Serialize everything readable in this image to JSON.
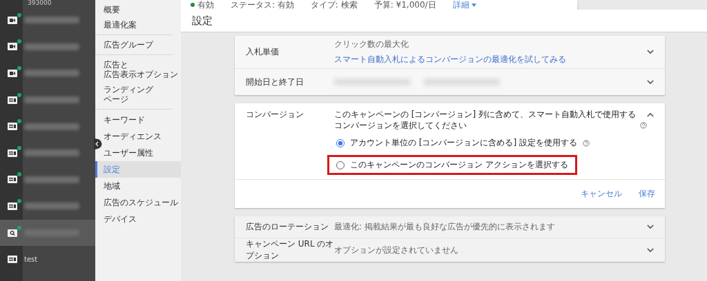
{
  "account": {
    "id": "393000"
  },
  "campaigns": [
    {
      "kind": "video",
      "active": true,
      "selected": false
    },
    {
      "kind": "video",
      "active": true,
      "selected": false
    },
    {
      "kind": "video",
      "active": true,
      "selected": false
    },
    {
      "kind": "display",
      "active": true,
      "selected": false
    },
    {
      "kind": "display",
      "active": true,
      "selected": false
    },
    {
      "kind": "display",
      "active": true,
      "selected": false
    },
    {
      "kind": "display",
      "active": true,
      "selected": false
    },
    {
      "kind": "display",
      "active": true,
      "selected": false
    },
    {
      "kind": "search",
      "active": true,
      "selected": true
    },
    {
      "kind": "display",
      "active": false,
      "selected": false,
      "name": "test"
    }
  ],
  "nav_groups": [
    [
      {
        "label": "概要",
        "selected": false
      },
      {
        "label": "最適化案",
        "selected": false
      }
    ],
    [
      {
        "label": "広告グループ",
        "selected": false
      }
    ],
    [
      {
        "lines": [
          "広告と",
          "広告表示オプション"
        ],
        "selected": false
      },
      {
        "lines": [
          "ランディング",
          "ページ"
        ],
        "selected": false
      }
    ],
    [
      {
        "label": "キーワード",
        "selected": false
      },
      {
        "label": "オーディエンス",
        "selected": false
      },
      {
        "label": "ユーザー属性",
        "selected": false
      },
      {
        "label": "設定",
        "selected": true
      },
      {
        "label": "地域",
        "selected": false
      },
      {
        "label": "広告のスケジュール",
        "selected": false
      },
      {
        "label": "デバイス",
        "selected": false
      }
    ]
  ],
  "summary_bar": {
    "status": "有効",
    "items": [
      "ステータス: 有効",
      "タイプ: 検索",
      "予算: ¥1,000/日"
    ],
    "details_link": "詳細",
    "details_caret": true
  },
  "page_title": "設定",
  "settings_top": [
    {
      "kind": "text",
      "label": "入札単価",
      "value": "クリック数の最大化",
      "link": "スマート自動入札によるコンバージョンの最適化を試してみる",
      "expanded": false
    },
    {
      "kind": "blurred",
      "label": "開始日と終了日",
      "expanded": false
    }
  ],
  "conversion": {
    "label": "コンバージョン",
    "expanded": true,
    "description_help": true,
    "description": "このキャンペーンの [コンバージョン] 列に含めて、スマート自動入札で使用するコンバージョンを選択してください",
    "options": [
      {
        "label": "アカウント単位の [コンバージョンに含める] 設定を使用する",
        "selected": true,
        "help": true,
        "highlighted": false
      },
      {
        "label": "このキャンペーンのコンバージョン アクションを選択する",
        "selected": false,
        "help": false,
        "highlighted": true
      }
    ],
    "buttons": [
      "キャンセル",
      "保存"
    ]
  },
  "settings_bottom": [
    {
      "kind": "text",
      "label": "広告のローテーション",
      "value": "最適化: 掲載結果が最も良好な広告が優先的に表示されます",
      "expanded": false
    },
    {
      "kind": "text",
      "label": "キャンペーン URL のオプション",
      "value": "オプションが設定されていません",
      "expanded": false
    }
  ]
}
